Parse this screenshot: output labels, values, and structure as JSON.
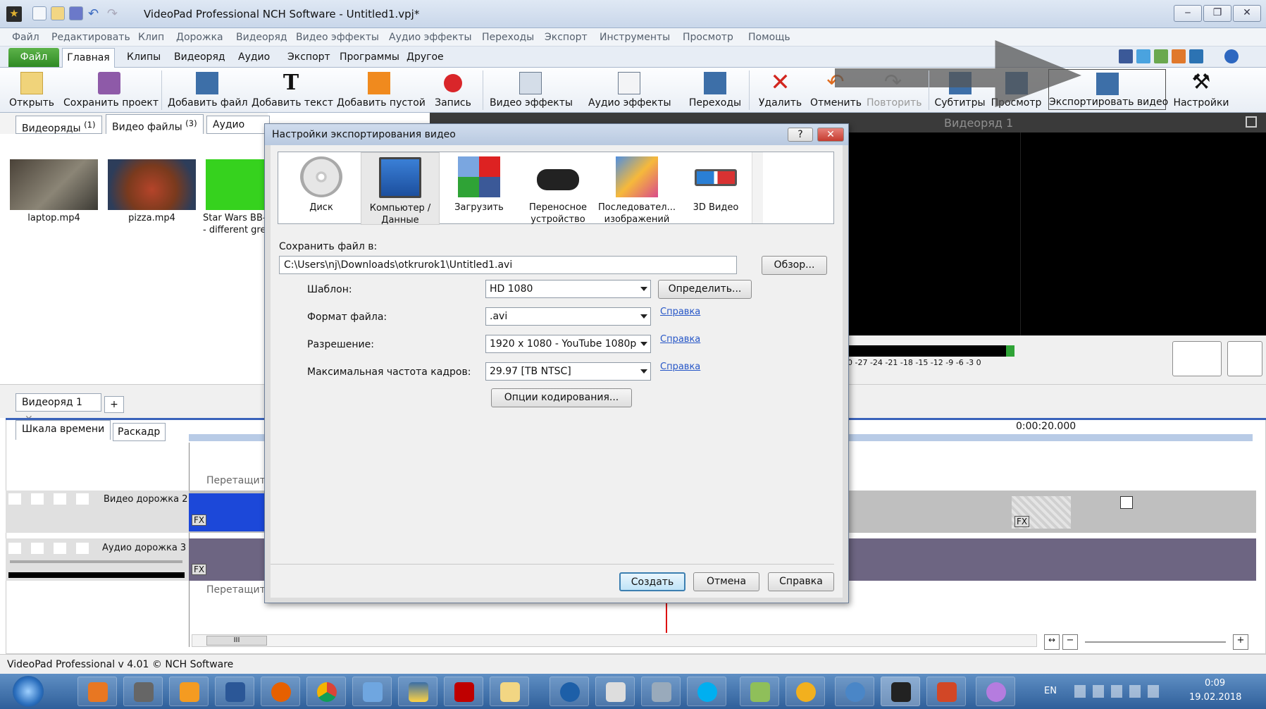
{
  "window": {
    "title": "VideoPad Professional NCH Software - Untitled1.vpj*"
  },
  "menu": [
    "Файл",
    "Редактировать",
    "Клип",
    "Дорожка",
    "Видеоряд",
    "Видео эффекты",
    "Аудио эффекты",
    "Переходы",
    "Экспорт",
    "Инструменты",
    "Просмотр",
    "Помощь"
  ],
  "ribbon_tabs": {
    "file": "Файл",
    "home": "Главная",
    "clips": "Клипы",
    "sequence": "Видеоряд",
    "audio": "Аудио",
    "export": "Экспорт",
    "programs": "Программы",
    "other": "Другое"
  },
  "toolbar": [
    "Открыть",
    "Сохранить проект",
    "Добавить файл",
    "Добавить текст",
    "Добавить пустой",
    "Запись",
    "Видео эффекты",
    "Аудио эффекты",
    "Переходы",
    "Удалить",
    "Отменить",
    "Повторить",
    "Субтитры",
    "Просмотр",
    "Экспортировать видео",
    "Настройки"
  ],
  "bins": {
    "tab1": "Видеоряды",
    "tab1_count": "(1)",
    "tab2": "Видео файлы",
    "tab2_count": "(3)",
    "tab3": "Аудио фай"
  },
  "clips": [
    {
      "name": "laptop.mp4"
    },
    {
      "name": "pizza.mp4"
    },
    {
      "name": "Star Wars BB-",
      "name2": "- different gre"
    }
  ],
  "preview": {
    "title": "Видеоряд 1",
    "meter": "0 -27 -24 -21 -18 -15 -12 -9 -6 -3 0"
  },
  "sequence_tabs": {
    "tab": "Видеоряд 1",
    "close": "✕",
    "add": "+"
  },
  "timeline": {
    "tab1": "Шкала времени",
    "tab2": "Раскадр",
    "time": "0:00:20.000",
    "drag_hint": "Перетащите",
    "video_track": "Видео дорожка 2",
    "audio_track": "Аудио дорожка 3",
    "fx": "FX",
    "scroll": "III"
  },
  "status": "VideoPad Professional v 4.01 © NCH Software",
  "dialog": {
    "title": "Настройки экспортирования видео",
    "help_q": "?",
    "close": "✕",
    "categories": [
      {
        "label": "Диск"
      },
      {
        "label": "Компьютер /",
        "label2": "Данные"
      },
      {
        "label": "Загрузить"
      },
      {
        "label": "Переносное",
        "label2": "устройство"
      },
      {
        "label": "Последовател...",
        "label2": "изображений"
      },
      {
        "label": "3D Видео"
      }
    ],
    "save_label": "Сохранить файл в:",
    "save_path": "C:\\Users\\nj\\Downloads\\otkrurok1\\Untitled1.avi",
    "browse": "Обзор...",
    "template_label": "Шаблон:",
    "template_value": "HD 1080",
    "detect": "Определить...",
    "format_label": "Формат файла:",
    "format_value": ".avi",
    "resolution_label": "Разрешение:",
    "resolution_value": "1920 x 1080 - YouTube 1080p",
    "fps_label": "Максимальная частота кадров:",
    "fps_value": "29.97 [ТВ NTSC]",
    "help_link": "Справка",
    "encoding": "Опции кодирования...",
    "create": "Создать",
    "cancel": "Отмена",
    "help": "Справка"
  },
  "taskbar": {
    "lang": "EN",
    "time": "0:09",
    "date": "19.02.2018"
  }
}
